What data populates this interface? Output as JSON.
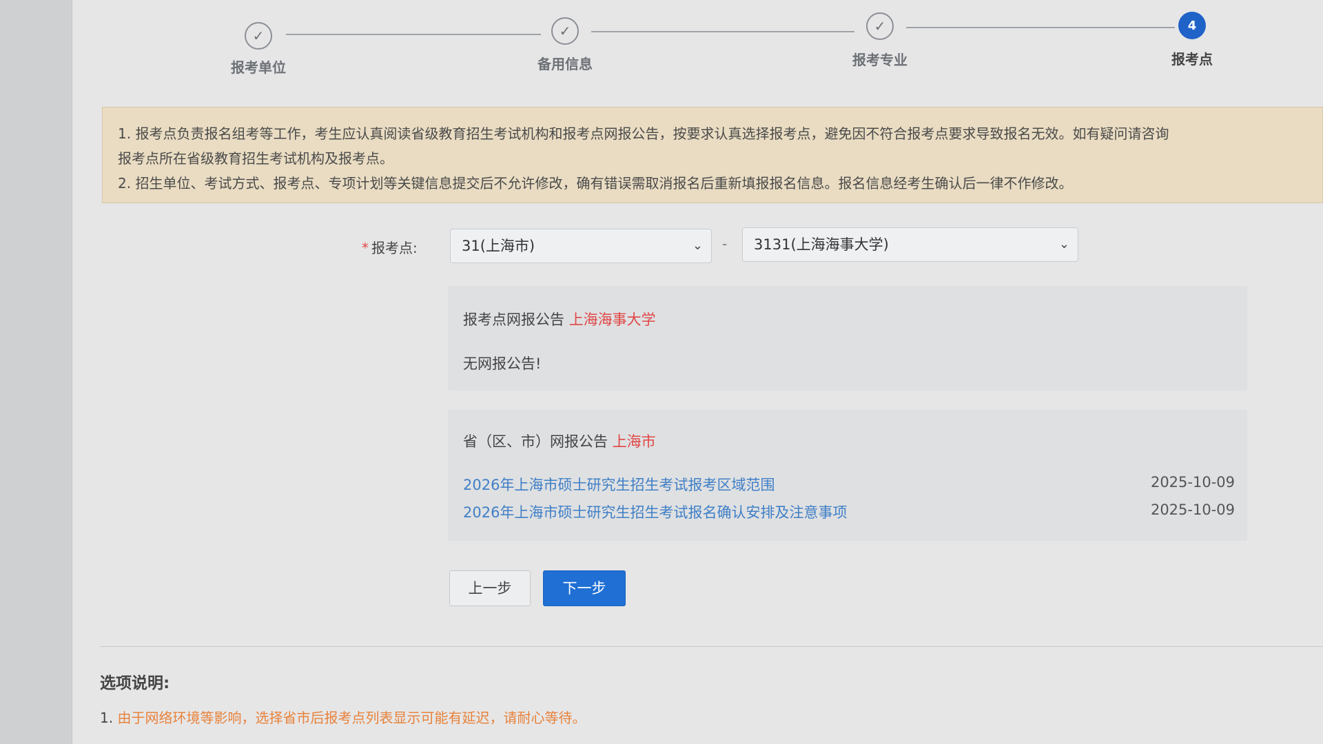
{
  "stepper": {
    "steps": [
      {
        "label": "报考单位",
        "state": "done",
        "icon": "check-icon",
        "glyph": "✓"
      },
      {
        "label": "备用信息",
        "state": "done",
        "icon": "check-icon",
        "glyph": "✓"
      },
      {
        "label": "报考专业",
        "state": "done",
        "icon": "check-icon",
        "glyph": "✓"
      },
      {
        "label": "报考点",
        "state": "active",
        "number": "4"
      }
    ]
  },
  "notice": {
    "line1": "1. 报考点负责报名组考等工作，考生应认真阅读省级教育招生考试机构和报考点网报公告，按要求认真选择报考点，避免因不符合报考点要求导致报名无效。如有疑问请咨询",
    "line2": "报考点所在省级教育招生考试机构及报考点。",
    "line3": "2. 招生单位、考试方式、报考点、专项计划等关键信息提交后不允许修改，确有错误需取消报名后重新填报报名信息。报名信息经考生确认后一律不作修改。"
  },
  "form": {
    "required_mark": "*",
    "label": "报考点:",
    "province_select": "31(上海市)",
    "separator": "-",
    "site_select": "3131(上海海事大学)"
  },
  "site_announcement": {
    "title": "报考点网报公告",
    "site_name": "上海海事大学",
    "empty_text": "无网报公告!"
  },
  "province_announcement": {
    "title": "省（区、市）网报公告",
    "province_name": "上海市",
    "items": [
      {
        "text": "2026年上海市硕士研究生招生考试报考区域范围",
        "date": "2025-10-09"
      },
      {
        "text": "2026年上海市硕士研究生招生考试报名确认安排及注意事项",
        "date": "2025-10-09"
      }
    ]
  },
  "buttons": {
    "prev": "上一步",
    "next": "下一步"
  },
  "options": {
    "title": "选项说明:",
    "line1_num": "1.",
    "line1_a": "由于网络环境等影响，",
    "line1_b": "选择省市后报考点列表显示可能有延迟，",
    "line1_c": "请耐心等待。"
  },
  "colors": {
    "accent": "#1f6fd4",
    "link": "#3f7fc6",
    "highlight_red": "#e04646",
    "notice_bg": "#e9dcc2"
  }
}
